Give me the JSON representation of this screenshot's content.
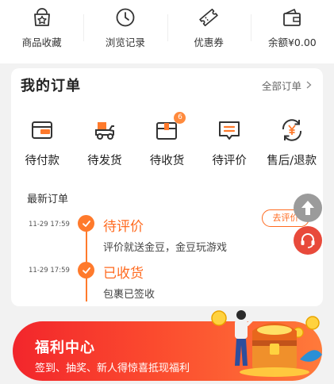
{
  "quick_links": [
    {
      "label": "商品收藏",
      "icon": "star-bag-icon"
    },
    {
      "label": "浏览记录",
      "icon": "clock-icon"
    },
    {
      "label": "优惠券",
      "icon": "ticket-icon"
    },
    {
      "label": "余额¥0.00",
      "icon": "wallet-icon"
    }
  ],
  "orders": {
    "title": "我的订单",
    "all_label": "全部订单",
    "statuses": [
      {
        "label": "待付款",
        "icon": "wallet-card-icon"
      },
      {
        "label": "待发货",
        "icon": "delivery-scooter-icon"
      },
      {
        "label": "待收货",
        "icon": "package-box-icon",
        "badge": "6"
      },
      {
        "label": "待评价",
        "icon": "comment-icon"
      },
      {
        "label": "售后/退款",
        "icon": "refund-yen-icon"
      }
    ],
    "recent_title": "最新订单",
    "recent": [
      {
        "time": "11-29 17:59",
        "status": "待评价",
        "desc": "评价就送金豆，金豆玩游戏",
        "action": "去评价"
      },
      {
        "time": "11-29 17:59",
        "status": "已收货",
        "desc": "包裹已签收"
      }
    ]
  },
  "welfare": {
    "title": "福利中心",
    "subtitle": "签到、抽奖、新人得惊喜抵现福利"
  },
  "colors": {
    "accent": "#ff6a1f",
    "banner_start": "#f2262c",
    "banner_end": "#ff7a3a",
    "service_button": "#e84a3b"
  }
}
